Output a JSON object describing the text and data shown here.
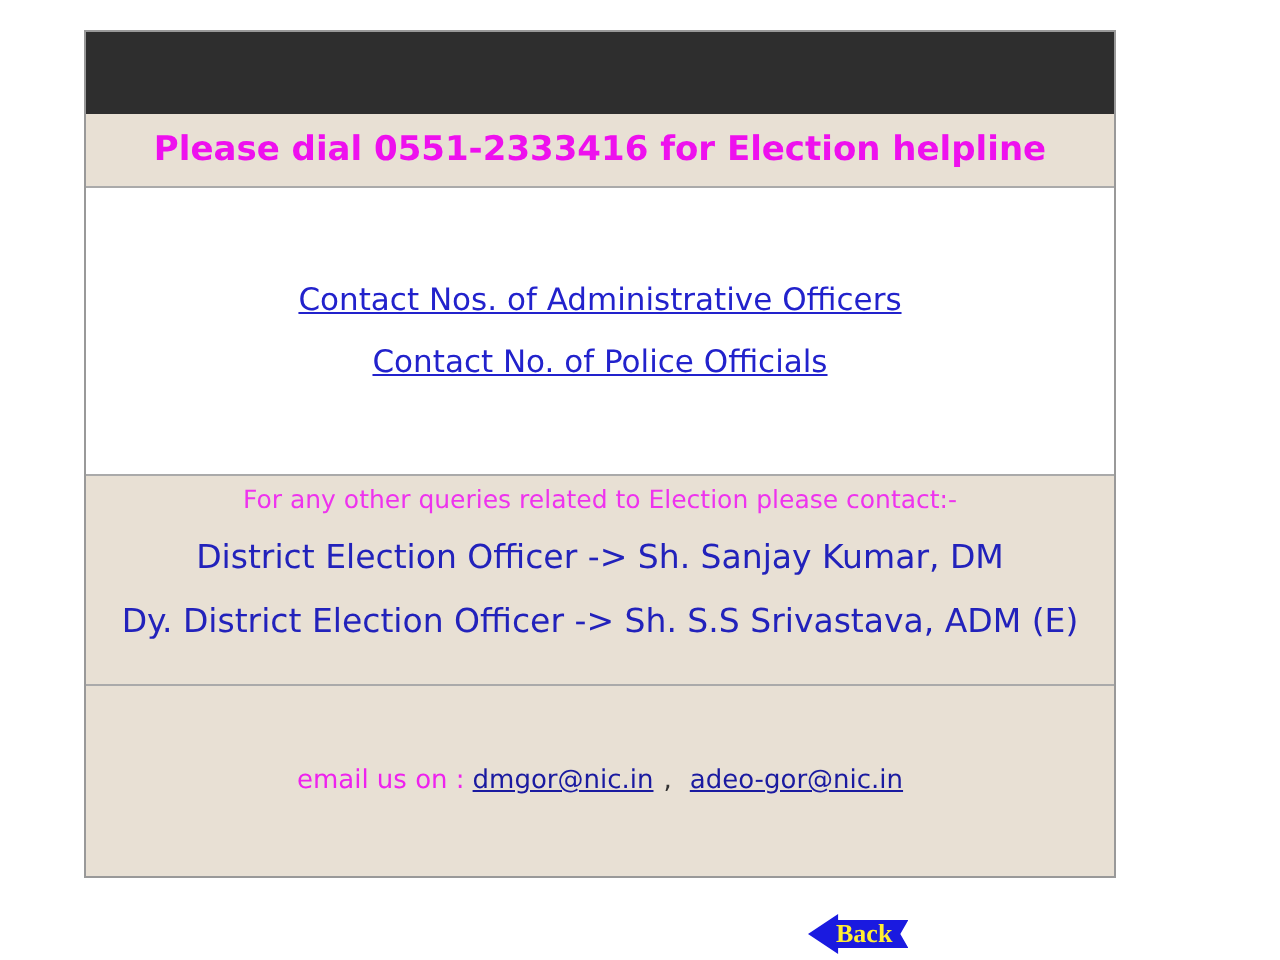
{
  "helpline": "Please dial 0551-2333416 for Election helpline",
  "links": [
    "Contact Nos. of Administrative Officers",
    "Contact No. of Police Officials"
  ],
  "queries": {
    "intro": "For any other queries related to Election please contact:-",
    "officers": [
      "District Election Officer -> Sh. Sanjay Kumar, DM",
      "Dy. District Election Officer -> Sh. S.S Srivastava, ADM (E)"
    ]
  },
  "email": {
    "label": "email us on :",
    "addresses": [
      "dmgor@nic.in",
      "adeo-gor@nic.in"
    ],
    "separator": ","
  },
  "back_button": "Back"
}
